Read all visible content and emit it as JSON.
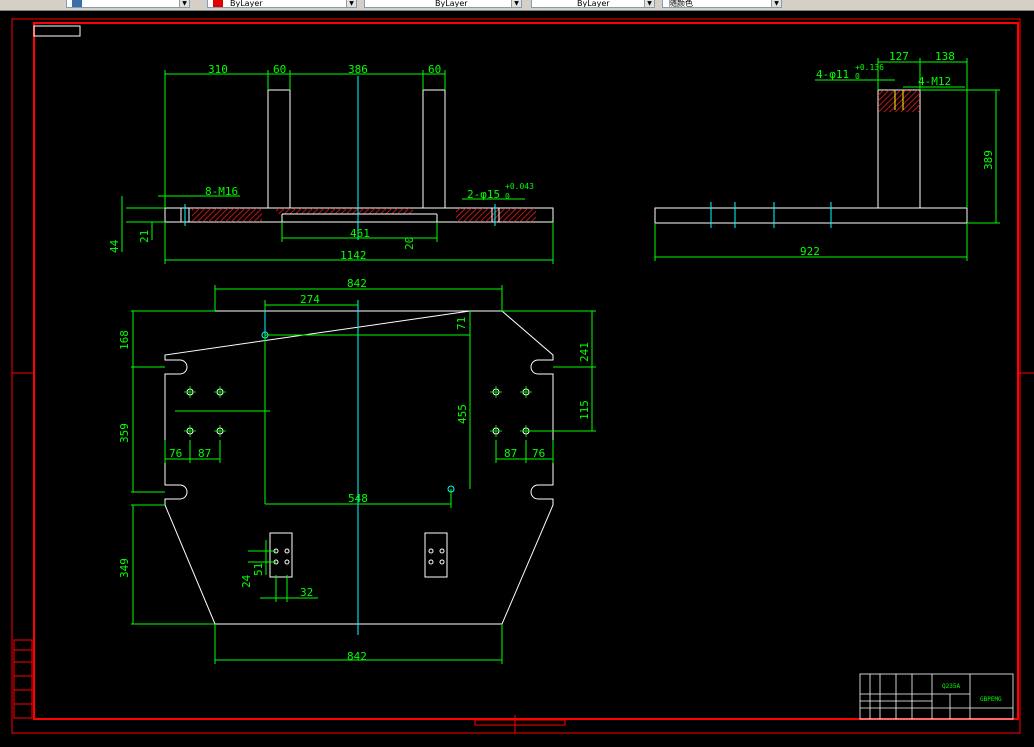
{
  "toolbar": {
    "layer_label": "",
    "color_label": "ByLayer",
    "linetype_label": "ByLayer",
    "lineweight_label": "ByLayer",
    "plotstyle_label": "随颜色"
  },
  "colors": {
    "background": "#000000",
    "frame": "#ff0000",
    "outline": "#ffffff",
    "dimension": "#00ff00",
    "center": "#00ffff",
    "hatch": "#ff2020"
  },
  "drawing": {
    "top_view": {
      "dims": {
        "d310": "310",
        "d60a": "60",
        "d386": "386",
        "d60b": "60",
        "m16": "8-M16",
        "hole15": "2-φ15",
        "hole15_tol": "+0.043",
        "hole15_tol0": "0",
        "d461": "461",
        "d20": "20",
        "d1142": "1142",
        "d44": "44",
        "d21": "21"
      }
    },
    "side_view": {
      "dims": {
        "hole11": "4-φ11",
        "hole11_tol": "+0.136",
        "hole11_tol0": "0",
        "d127": "127",
        "d138": "138",
        "m12": "4-M12",
        "d389": "389",
        "d922": "922"
      }
    },
    "plan_view": {
      "dims": {
        "d842top": "842",
        "d274": "274",
        "d71": "71",
        "d168": "168",
        "d241": "241",
        "d455": "455",
        "d115": "115",
        "d359": "359",
        "d76l": "76",
        "d87l": "87",
        "d87r": "87",
        "d76r": "76",
        "d548": "548",
        "d349": "349",
        "d51": "51",
        "d24": "24",
        "d32": "32",
        "d842bot": "842"
      }
    },
    "title_block": {
      "material": "Q235A",
      "drawing_no": "GBPEMG"
    }
  }
}
